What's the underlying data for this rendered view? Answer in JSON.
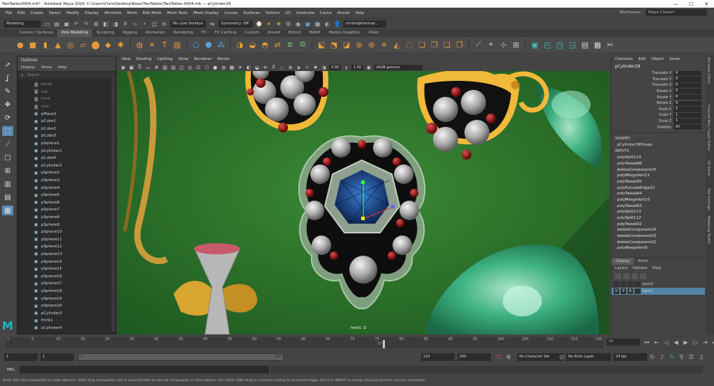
{
  "window": {
    "title": "TwoTables0004.mb* - Autodesk Maya 2020: C:\\Users\\Chris\\Desktop\\Bops\\TwoTables\\TwoTables.0004.mb  ---  pCylinder28",
    "minimize": "—",
    "maximize": "☐",
    "close": "✕"
  },
  "menubar": {
    "items": [
      "File",
      "Edit",
      "Create",
      "Select",
      "Modify",
      "Display",
      "Windows",
      "Mesh",
      "Edit Mesh",
      "Mesh Tools",
      "Mesh Display",
      "Curves",
      "Surfaces",
      "Deform",
      "UV",
      "Generate",
      "Cache",
      "Arnold",
      "Help"
    ],
    "workspace_label": "Workspace :",
    "workspace_value": "Maya Classic*"
  },
  "statusline": {
    "mode": "Modeling",
    "live_surface": "No Live Surface",
    "symmetry": "Symmetry: Off",
    "user": "christophermar..."
  },
  "shelf": {
    "tabs": [
      "Curves / Surfaces",
      "Poly Modeling",
      "Sculpting",
      "Rigging",
      "Animation",
      "Rendering",
      "FX",
      "FX Caching",
      "Custom",
      "Arnold",
      "Bifrost",
      "MASH",
      "Motion Graphics",
      "XGen"
    ],
    "active_tab": "Poly Modeling"
  },
  "outliner": {
    "title": "Outliner",
    "menu": [
      "Display",
      "Show",
      "Help"
    ],
    "search_placeholder": "Search...",
    "items": [
      {
        "label": "persp",
        "camera": true
      },
      {
        "label": "top",
        "camera": true
      },
      {
        "label": "front",
        "camera": true
      },
      {
        "label": "side",
        "camera": true
      },
      {
        "label": "pPlane1"
      },
      {
        "label": "pCube1"
      },
      {
        "label": "pCube2"
      },
      {
        "label": "pCube3"
      },
      {
        "label": "pSphere1"
      },
      {
        "label": "pCylinder1"
      },
      {
        "label": "pCube4"
      },
      {
        "label": "pCylinder2"
      },
      {
        "label": "pSphere2"
      },
      {
        "label": "pSphere3"
      },
      {
        "label": "pSphere4"
      },
      {
        "label": "pSphere5"
      },
      {
        "label": "pSphere6"
      },
      {
        "label": "pSphere7"
      },
      {
        "label": "pSphere8"
      },
      {
        "label": "pSphere9"
      },
      {
        "label": "pSphere10"
      },
      {
        "label": "pSphere11"
      },
      {
        "label": "pSphere12"
      },
      {
        "label": "pSphere13"
      },
      {
        "label": "pSphere14"
      },
      {
        "label": "pSphere15"
      },
      {
        "label": "pSphere16"
      },
      {
        "label": "pSphere17"
      },
      {
        "label": "pSphere18"
      },
      {
        "label": "pSphere19"
      },
      {
        "label": "pSphere20"
      },
      {
        "label": "pCylinder3"
      },
      {
        "label": "front1"
      },
      {
        "label": "pCylinder4"
      }
    ]
  },
  "viewport": {
    "menu": [
      "View",
      "Shading",
      "Lighting",
      "Show",
      "Renderer",
      "Panels"
    ],
    "exposure": "0.00",
    "gamma": "1.00",
    "colorspace": "sRGB gamma",
    "camera_label": "front1 -Z"
  },
  "channelbox": {
    "tabs_label": "Channel Box / Layer Editor",
    "menu": [
      "Channels",
      "Edit",
      "Object",
      "Show"
    ],
    "object": "pCylinder28",
    "attributes": [
      {
        "name": "Translate X",
        "value": "0"
      },
      {
        "name": "Translate Y",
        "value": "0"
      },
      {
        "name": "Translate Z",
        "value": "0"
      },
      {
        "name": "Rotate X",
        "value": "0"
      },
      {
        "name": "Rotate Y",
        "value": "0"
      },
      {
        "name": "Rotate Z",
        "value": "0"
      },
      {
        "name": "Scale X",
        "value": "1"
      },
      {
        "name": "Scale Y",
        "value": "1"
      },
      {
        "name": "Scale Z",
        "value": "1"
      },
      {
        "name": "Visibility",
        "value": "on"
      }
    ],
    "shapes_header": "SHAPES",
    "shape": "pCylinder28Shape",
    "inputs_header": "INPUTS",
    "inputs": [
      "polySplit114",
      "polyTweak66",
      "deleteComponent25",
      "polyMergeVert11",
      "polyTweak65",
      "polyExtrudeEdge23",
      "polyTweak64",
      "polyMergeVert10",
      "polyTweak63",
      "polySplit113",
      "polySplit112",
      "polyTweak62",
      "deleteComponent24",
      "deleteComponent23",
      "deleteComponent22",
      "polyMergeVert9"
    ]
  },
  "layers": {
    "tabs": [
      "Display",
      "Anim"
    ],
    "menu": [
      "Layers",
      "Options",
      "Help"
    ],
    "rows": [
      {
        "name": "layer2",
        "v": "",
        "p": "",
        "r": "",
        "selected": false
      },
      {
        "name": "layer1",
        "v": "V",
        "p": "P",
        "r": "R",
        "selected": true
      }
    ]
  },
  "side_tabs": [
    "Attribute Editor",
    "Channel Box / Layer Editor",
    "UV Editor",
    "Tool Settings",
    "Modeling Toolkit"
  ],
  "timeline": {
    "ticks": [
      "1",
      "5",
      "10",
      "15",
      "20",
      "25",
      "30",
      "35",
      "40",
      "45",
      "50",
      "55",
      "60",
      "65",
      "70",
      "75",
      "80",
      "85",
      "90",
      "95",
      "100",
      "105",
      "110",
      "115",
      "120"
    ],
    "current_frame": "77",
    "current_frame_field": "77"
  },
  "range": {
    "start": "1",
    "start_inner": "1",
    "range_label_left": "1",
    "range_label_right": "120",
    "end_inner": "120",
    "end": "200",
    "character_set": "No Character Set",
    "anim_layer": "No Anim Layer",
    "fps": "24 fps"
  },
  "cmdline": {
    "label": "MEL"
  },
  "helpline": "Scale Tool: Use manipulator to scale object(s). Shift+drag manipulator axis or plane handles to extrude components or clone objects. Ctrl+Shift+LMB+drag to constrain scaling to connected edges. Use D or INSERT to change the pivot position and axis orientation.",
  "colors": {
    "accent": "#5285a6",
    "maya_logo": "#20b7c8",
    "viewport_bg": "#2d6b2b"
  }
}
